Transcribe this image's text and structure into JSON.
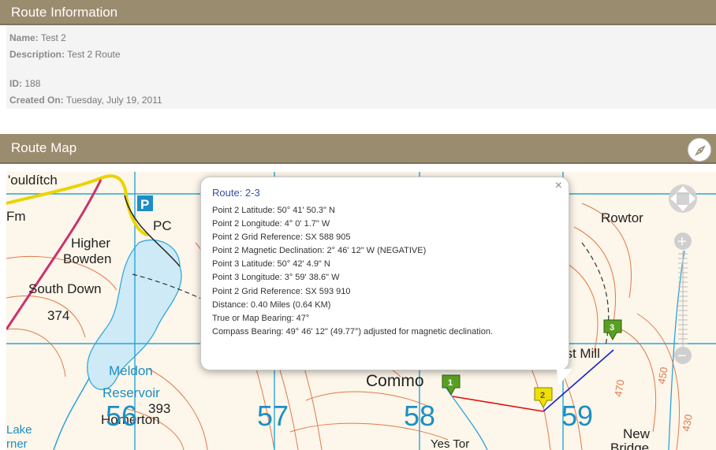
{
  "route_info": {
    "header": "Route Information",
    "name_label": "Name:",
    "name_value": "Test 2",
    "description_label": "Description:",
    "description_value": "Test 2 Route",
    "id_label": "ID:",
    "id_value": "188",
    "created_label": "Created On:",
    "created_value": "Tuesday, July 19, 2011"
  },
  "route_map": {
    "header": "Route Map"
  },
  "map_labels": {
    "vouldítch": "'ouldítch",
    "fm": "Fm",
    "higher": "Higher",
    "bowden": "Bowden",
    "south_down": "South Down",
    "h374": "374",
    "pc": "PC",
    "p": "P",
    "meldon": "Meldon",
    "reservoir": "Reservoir",
    "g56": "56",
    "h393": "393",
    "g57": "57",
    "g58": "58",
    "g59": "59",
    "lake": "Lake",
    "rner": "rner",
    "homerton": "Homerton",
    "yes_tor": "Yes Tor",
    "common": "Commo",
    "rowtor": "Rowtor",
    "west_mill": "est Mill",
    "new": "New",
    "bridge": "Bridge",
    "c470": "470",
    "c450": "450",
    "c430": "430"
  },
  "markers": [
    "1",
    "2",
    "3"
  ],
  "popup": {
    "title": "Route: 2-3",
    "close": "×",
    "lines": [
      "Point 2 Latitude: 50° 41' 50.3\" N",
      "Point 2 Longitude: 4° 0' 1.7\" W",
      "Point 2 Grid Reference: SX 588 905",
      "Point 2 Magnetic Declination: 2° 46' 12\" W (NEGATIVE)",
      "Point 3 Latitude: 50° 42' 4.9\" N",
      "Point 3 Longitude: 3° 59' 38.6\" W",
      "Point 2 Grid Reference: SX 593 910",
      "Distance: 0.40 Miles (0.64 KM)",
      "True or Map Bearing: 47°",
      "Compass Bearing: 49° 46' 12\" (49.77°) adjusted for magnetic declination."
    ]
  },
  "zoom": {
    "in": "+",
    "out": "−"
  },
  "colors": {
    "header_bg": "#9a8c6e",
    "contour": "#e07a4a",
    "water": "#2aa3d8",
    "grid": "#27a7d8",
    "route_red": "#e01010",
    "route_blue": "#1020d0",
    "marker_green": "#5a9f24",
    "marker_yellow": "#f0e000",
    "popup_title": "#3b4fa0"
  }
}
